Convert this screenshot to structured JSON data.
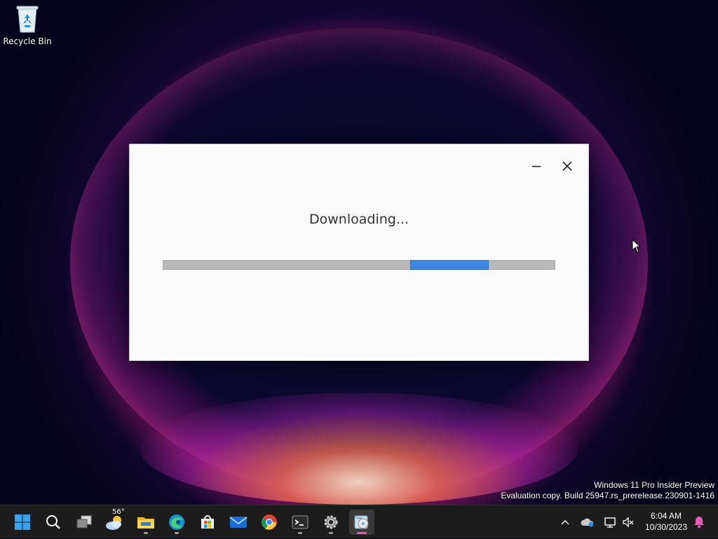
{
  "desktop": {
    "icons": [
      {
        "label": "Recycle Bin"
      }
    ],
    "watermark": {
      "line1": "Windows 11 Pro Insider Preview",
      "line2": "Evaluation copy. Build 25947.rs_prerelease.230901-1416"
    }
  },
  "dialog": {
    "status_text": "Downloading...",
    "progress": {
      "mode": "indeterminate"
    },
    "controls": [
      "minimize-icon",
      "close-icon"
    ]
  },
  "taskbar": {
    "pinned": [
      {
        "name": "start-button",
        "icon": "windows-logo-icon"
      },
      {
        "name": "search-button",
        "icon": "search-icon"
      },
      {
        "name": "task-view-button",
        "icon": "task-view-icon"
      },
      {
        "name": "weather-widget",
        "icon": "weather-icon",
        "text": "56°"
      },
      {
        "name": "file-explorer-button",
        "icon": "folder-icon"
      },
      {
        "name": "edge-button",
        "icon": "edge-icon"
      },
      {
        "name": "store-button",
        "icon": "store-icon"
      },
      {
        "name": "mail-button",
        "icon": "mail-icon"
      },
      {
        "name": "chrome-button",
        "icon": "chrome-icon"
      },
      {
        "name": "terminal-button",
        "icon": "terminal-icon"
      },
      {
        "name": "settings-button",
        "icon": "gear-icon"
      },
      {
        "name": "setup-app-button",
        "icon": "setup-icon",
        "active": true
      }
    ],
    "weather_temp": "56°",
    "clock": {
      "time": "6:04 AM",
      "date": "10/30/2023"
    }
  },
  "colors": {
    "progress_fill": "#3c86e6",
    "progress_track": "#b9b9b9",
    "taskbar_bg": "#1c1c1c",
    "dialog_bg": "#fafafa"
  }
}
